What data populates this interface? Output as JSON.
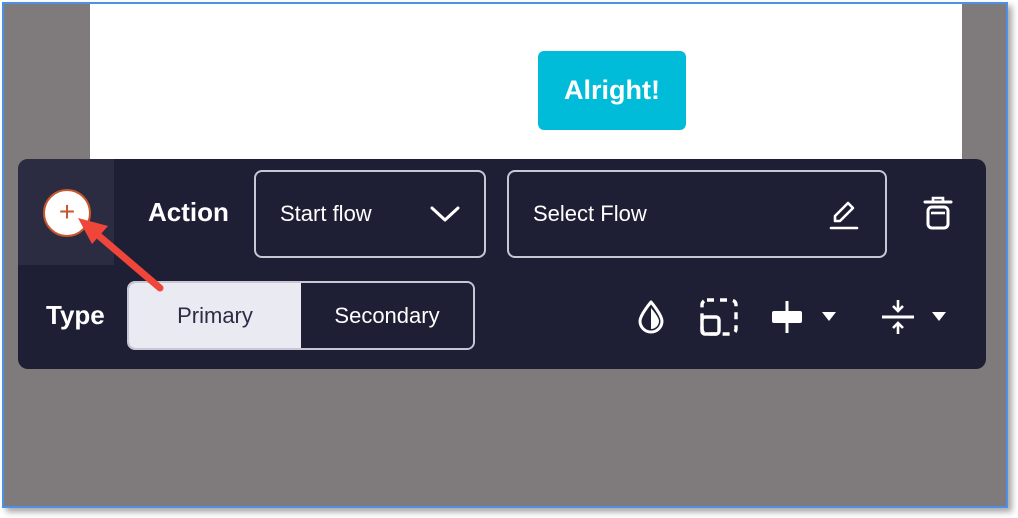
{
  "preview": {
    "cta_label": "Alright!"
  },
  "toolbar": {
    "add_symbol": "+",
    "action_label": "Action",
    "action_select_value": "Start flow",
    "flow_select_value": "Select Flow",
    "type_label": "Type",
    "type_options": [
      "Primary",
      "Secondary"
    ],
    "type_selected": "Primary"
  },
  "icons": {
    "add": "plus-icon",
    "dropdown": "chevron-down-icon",
    "edit": "pencil-icon",
    "delete": "trash-icon",
    "color": "droplet-icon",
    "resize": "resize-icon",
    "align": "align-center-icon",
    "spacing": "spacing-icon"
  },
  "colors": {
    "accent": "#00bcd8",
    "toolbar_bg": "#1e1f34",
    "add_ring": "#c6562c",
    "annotation_arrow": "#f0463a",
    "outer_frame": "#4f8fe8"
  }
}
